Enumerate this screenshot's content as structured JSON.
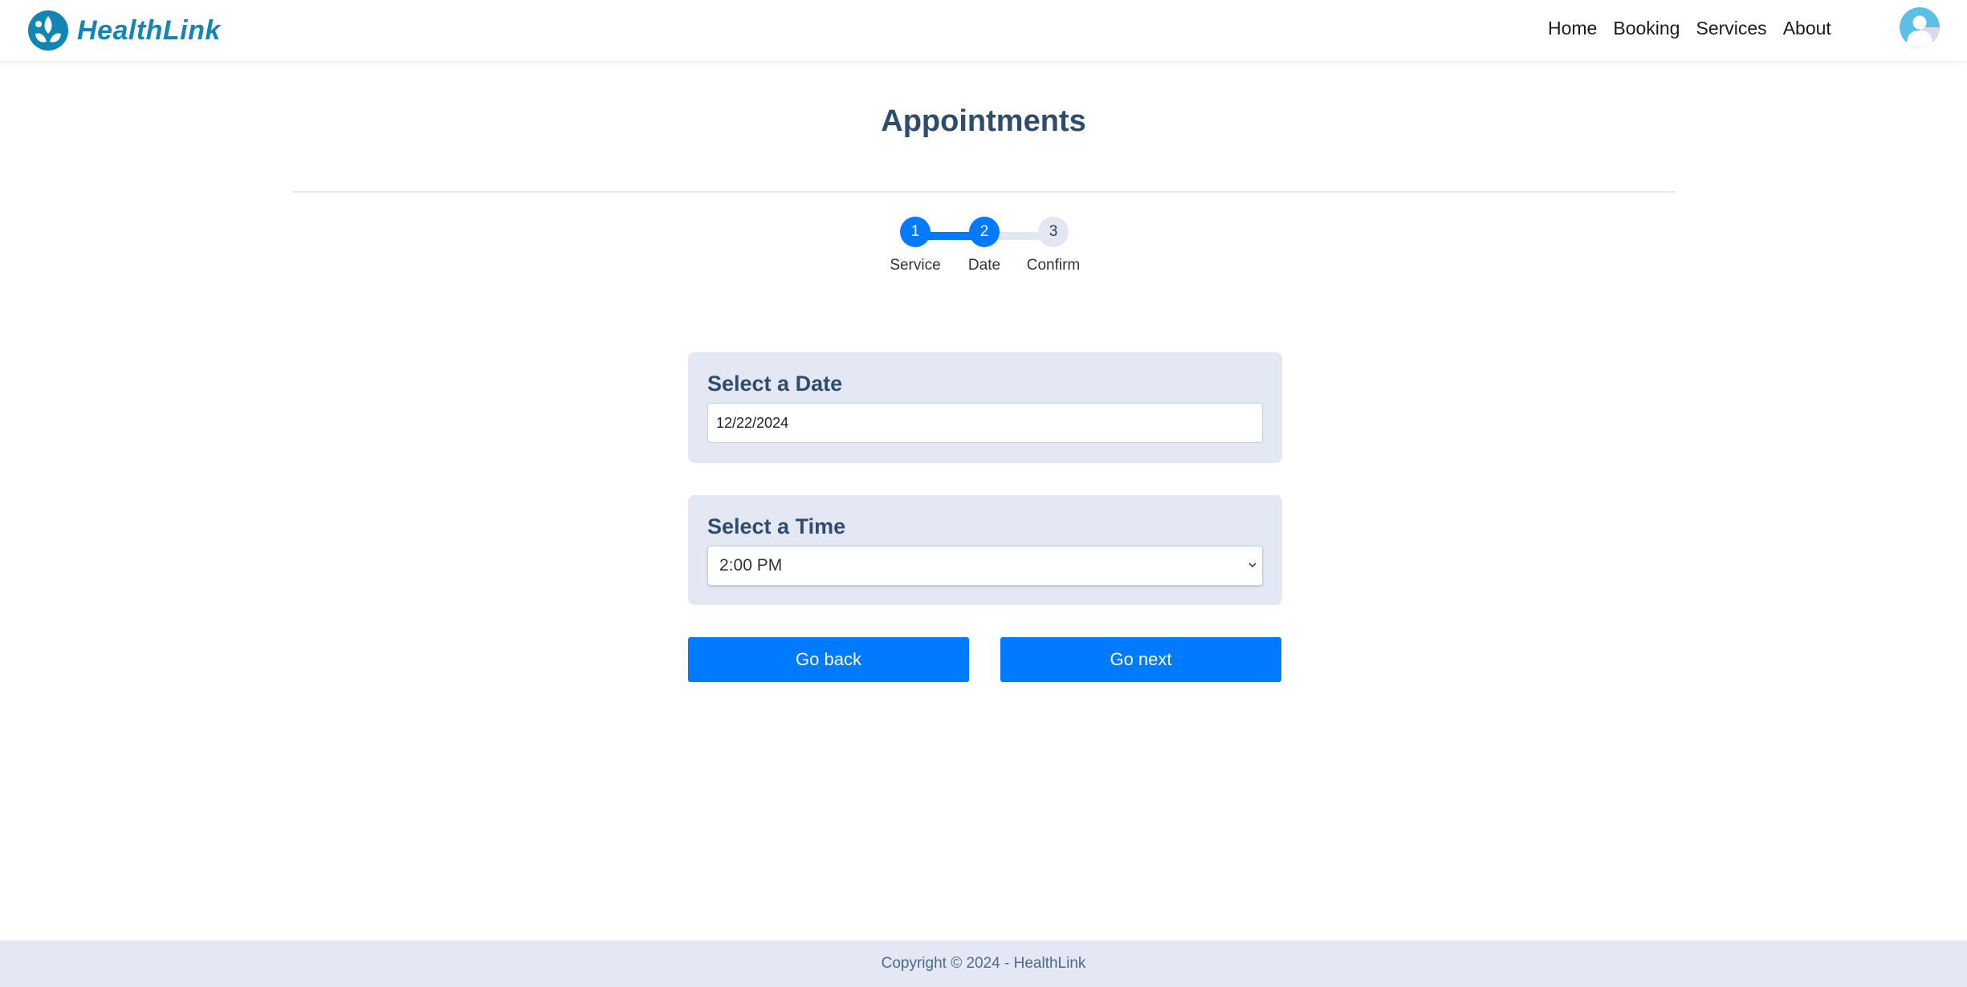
{
  "header": {
    "brand": "HealthLink",
    "logo_icon": "leaf-hands-icon",
    "brand_color": "#1185b4",
    "nav": [
      {
        "label": "Home"
      },
      {
        "label": "Booking"
      },
      {
        "label": "Services"
      },
      {
        "label": "About"
      }
    ],
    "avatar_icon": "user-avatar-icon"
  },
  "page": {
    "title": "Appointments"
  },
  "stepper": {
    "current_step": 2,
    "accent": "#007bff",
    "steps": [
      {
        "number": "1",
        "label": "Service",
        "state": "complete"
      },
      {
        "number": "2",
        "label": "Date",
        "state": "active"
      },
      {
        "number": "3",
        "label": "Confirm",
        "state": "pending"
      }
    ]
  },
  "date_card": {
    "title": "Select a Date",
    "value": "12/22/2024"
  },
  "time_card": {
    "title": "Select a Time",
    "selected": "2:00 PM",
    "chevron_icon": "chevron-down-icon"
  },
  "actions": {
    "back_label": "Go back",
    "next_label": "Go next",
    "button_color": "#007bff"
  },
  "footer": {
    "text": "Copyright © 2024 - HealthLink"
  }
}
